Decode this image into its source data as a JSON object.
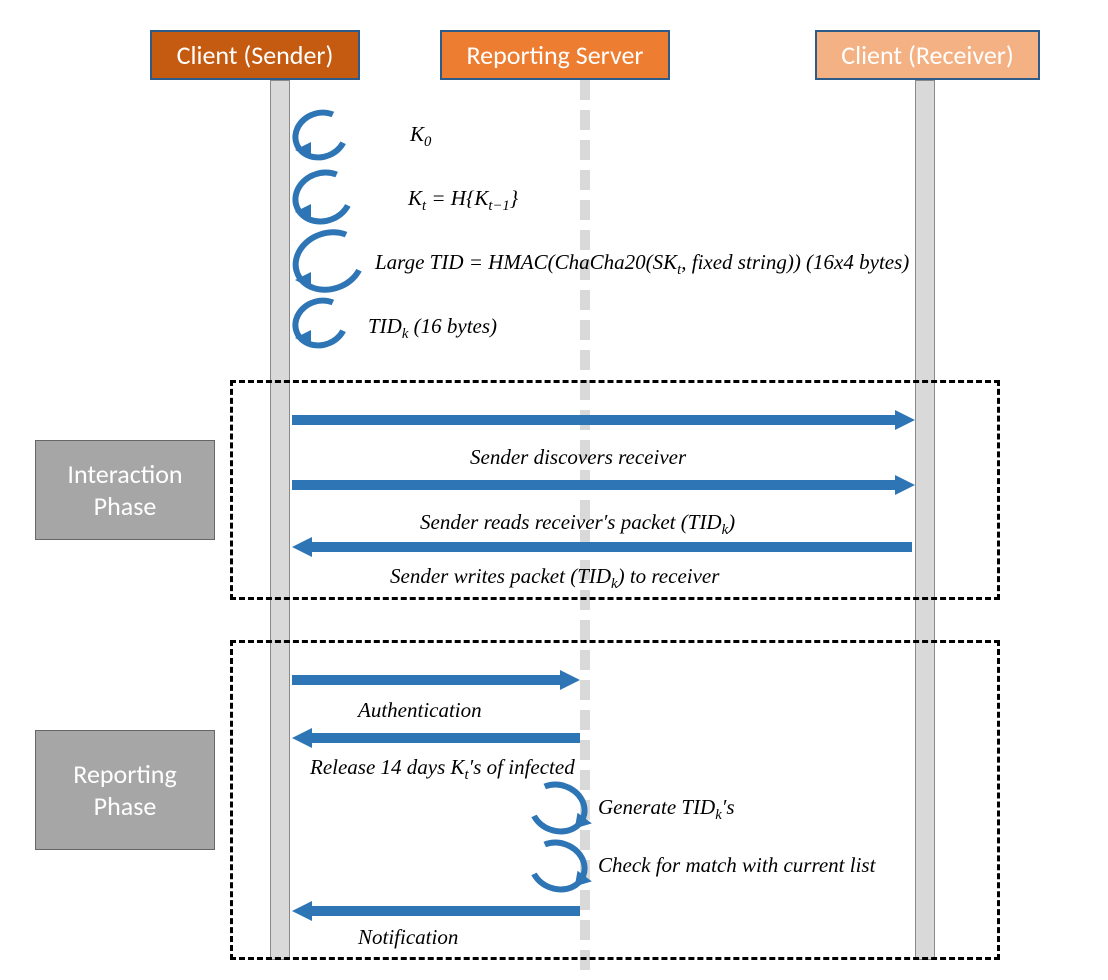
{
  "headers": {
    "sender": {
      "text": "Client (Sender)",
      "color": "#C55A11"
    },
    "server": {
      "text": "Reporting Server",
      "color": "#ED7D31"
    },
    "receiver": {
      "text": "Client (Receiver)",
      "color": "#F4B183"
    }
  },
  "phases": {
    "interaction": "Interaction\nPhase",
    "reporting": "Reporting\nPhase"
  },
  "steps": {
    "k0": "K",
    "k0_sub": "0",
    "kt": "K",
    "kt_sub": "t",
    "kt_eq": " = H{K",
    "kt_eq_sub": "t−1",
    "kt_eq_end": "}",
    "large_tid": "Large TID = HMAC(ChaCha20(SK",
    "large_tid_sub": "t",
    "large_tid_mid": ", fixed string)) (16x4 bytes)",
    "tidk": "TID",
    "tidk_sub": "k",
    "tidk_end": " (16 bytes)",
    "discover": "Sender discovers receiver",
    "reads": "Sender reads receiver′s packet (TID",
    "reads_sub": "k",
    "reads_end": ")",
    "writes": "Sender writes packet (TID",
    "writes_sub": "k",
    "writes_end": ") to receiver",
    "auth": "Authentication",
    "release": "Release 14 days K",
    "release_sub": "t",
    "release_end": "′s of infected",
    "gen": "Generate TID",
    "gen_sub": "k",
    "gen_end": "′s",
    "check": "Check for match with current list",
    "notif": "Notification"
  }
}
